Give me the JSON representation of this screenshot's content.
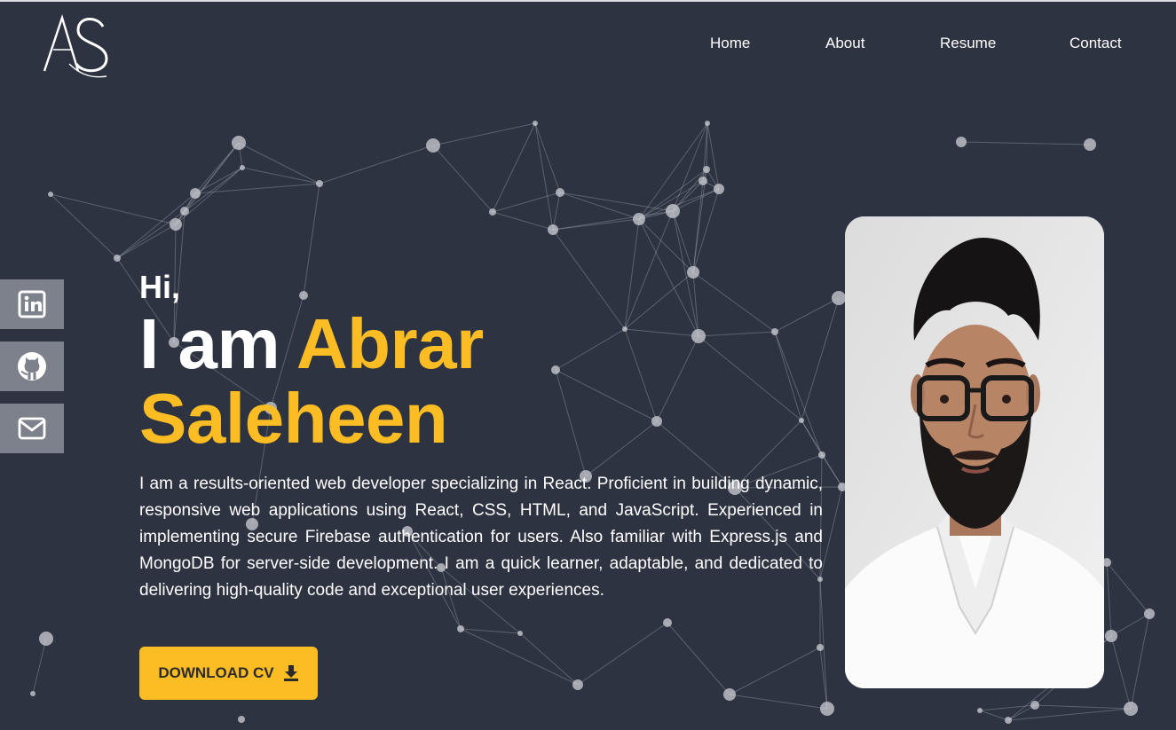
{
  "brand": {
    "logo_text": "AS"
  },
  "nav": {
    "items": [
      {
        "label": "Home"
      },
      {
        "label": "About"
      },
      {
        "label": "Resume"
      },
      {
        "label": "Contact"
      }
    ]
  },
  "social": {
    "items": [
      {
        "icon": "linkedin-icon"
      },
      {
        "icon": "github-icon"
      },
      {
        "icon": "mail-icon"
      }
    ]
  },
  "hero": {
    "greeting": "Hi,",
    "intro": "I am",
    "first_name": "Abrar",
    "last_name": "Saleheen",
    "bio": "I am a results-oriented web developer specializing in React. Proficient in building dynamic, responsive web applications using React, CSS, HTML, and JavaScript. Experienced in implementing secure Firebase authentication for users. Also familiar with Express.js and MongoDB for server-side development. I am a quick learner, adaptable, and dedicated to delivering high-quality code and exceptional user experiences.",
    "download_label": "DOWNLOAD CV"
  },
  "colors": {
    "background": "#2d3340",
    "accent": "#fbbd23",
    "text": "#ffffff",
    "social_bg": "#7d818b"
  }
}
